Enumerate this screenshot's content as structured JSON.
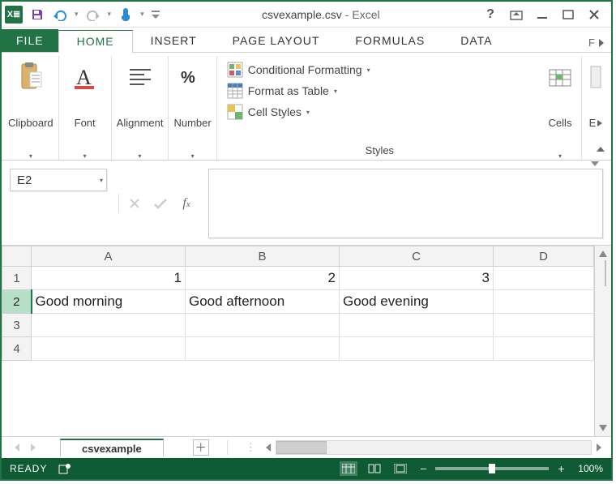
{
  "titlebar": {
    "filename": "csvexample.csv",
    "appname": "Excel",
    "separator": "-"
  },
  "tabs": {
    "file": "FILE",
    "items": [
      "HOME",
      "INSERT",
      "PAGE LAYOUT",
      "FORMULAS",
      "DATA"
    ],
    "active": 0,
    "more": "F"
  },
  "ribbon": {
    "clipboard": "Clipboard",
    "font": "Font",
    "alignment": "Alignment",
    "number": "Number",
    "styles": {
      "conditional": "Conditional Formatting",
      "table": "Format as Table",
      "cell": "Cell Styles",
      "label": "Styles"
    },
    "cells": "Cells",
    "editing": "E"
  },
  "formula": {
    "namebox": "E2",
    "value": ""
  },
  "columns": [
    "A",
    "B",
    "C",
    "D"
  ],
  "rows": [
    {
      "n": "1",
      "cells": [
        {
          "v": "1",
          "t": "num"
        },
        {
          "v": "2",
          "t": "num"
        },
        {
          "v": "3",
          "t": "num"
        },
        {
          "v": "",
          "t": "txt"
        }
      ]
    },
    {
      "n": "2",
      "cells": [
        {
          "v": "Good morning",
          "t": "txt"
        },
        {
          "v": "Good afternoon",
          "t": "txt"
        },
        {
          "v": "Good evening",
          "t": "txt"
        },
        {
          "v": "",
          "t": "txt"
        }
      ],
      "selected": true
    },
    {
      "n": "3",
      "cells": [
        {
          "v": "",
          "t": "txt"
        },
        {
          "v": "",
          "t": "txt"
        },
        {
          "v": "",
          "t": "txt"
        },
        {
          "v": "",
          "t": "txt"
        }
      ]
    },
    {
      "n": "4",
      "cells": [
        {
          "v": "",
          "t": "txt"
        },
        {
          "v": "",
          "t": "txt"
        },
        {
          "v": "",
          "t": "txt"
        },
        {
          "v": "",
          "t": "txt"
        }
      ]
    }
  ],
  "sheet": {
    "name": "csvexample"
  },
  "status": {
    "ready": "READY",
    "zoom": "100%"
  }
}
